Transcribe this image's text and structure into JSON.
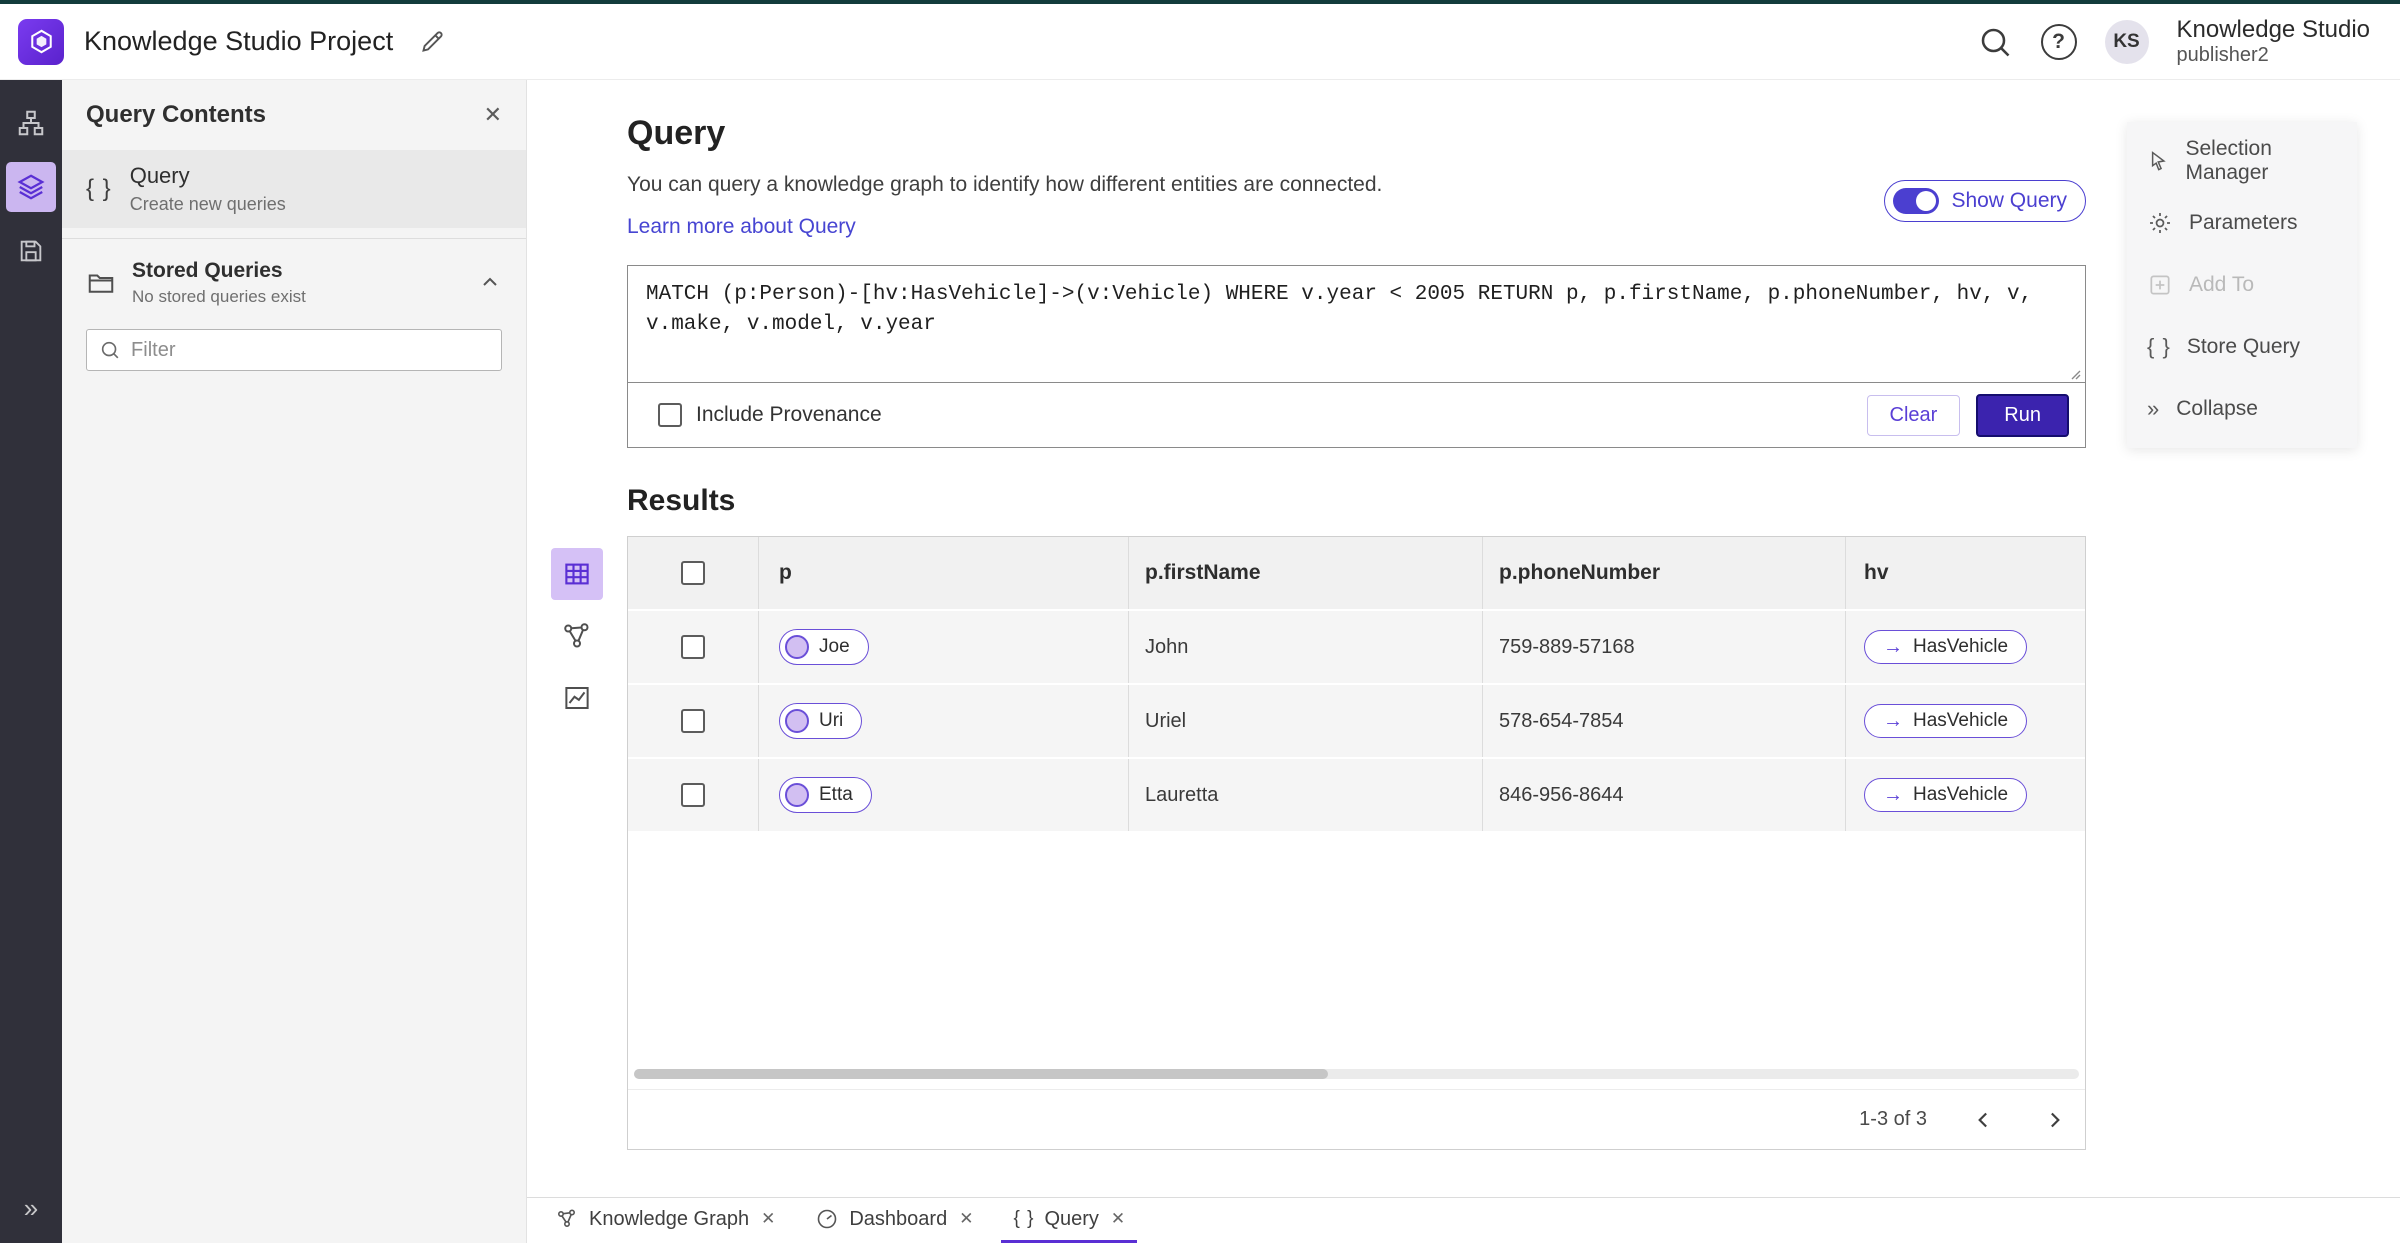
{
  "colors": {
    "accent_purple": "#5a2fd4",
    "run_button": "#3b23ae",
    "link": "#4745d2",
    "toggle": "#4b3fd0",
    "rail_bg": "#30303a",
    "panel_bg": "#f4f4f4",
    "node_pill_fill": "#d2bff2"
  },
  "icons": {
    "braces": "{ }",
    "close": "✕",
    "collapse": "»",
    "edge_arrow": "→",
    "help": "?"
  },
  "header": {
    "app_title": "Knowledge Studio Project",
    "user_initials": "KS",
    "account_name": "Knowledge Studio",
    "account_role": "publisher2"
  },
  "left_panel": {
    "title": "Query Contents",
    "query_item": {
      "label": "Query",
      "sublabel": "Create new queries"
    },
    "stored_queries": {
      "label": "Stored Queries",
      "sublabel": "No stored queries exist"
    },
    "filter_placeholder": "Filter"
  },
  "query": {
    "title": "Query",
    "description": "You can query a knowledge graph to identify how different entities are connected.",
    "learn_more": "Learn more about Query",
    "show_query": "Show Query",
    "text": "MATCH (p:Person)-[hv:HasVehicle]->(v:Vehicle) WHERE v.year < 2005 RETURN p, p.firstName, p.phoneNumber, hv, v, v.make, v.model, v.year",
    "include_provenance": "Include Provenance",
    "clear": "Clear",
    "run": "Run"
  },
  "results": {
    "title": "Results",
    "columns": [
      "p",
      "p.firstName",
      "p.phoneNumber",
      "hv"
    ],
    "rows": [
      {
        "p": "Joe",
        "firstName": "John",
        "phone": "759-889-57168",
        "hv": "HasVehicle"
      },
      {
        "p": "Uri",
        "firstName": "Uriel",
        "phone": "578-654-7854",
        "hv": "HasVehicle"
      },
      {
        "p": "Etta",
        "firstName": "Lauretta",
        "phone": "846-956-8644",
        "hv": "HasVehicle"
      }
    ],
    "pagination": "1-3 of 3"
  },
  "right_menu": {
    "items": [
      {
        "label": "Selection Manager",
        "icon": "selection-manager-icon",
        "disabled": false
      },
      {
        "label": "Parameters",
        "icon": "parameters-icon",
        "disabled": false
      },
      {
        "label": "Add To",
        "icon": "add-to-icon",
        "disabled": true
      },
      {
        "label": "Store Query",
        "icon": "store-query-icon",
        "disabled": false
      },
      {
        "label": "Collapse",
        "icon": "collapse-icon",
        "disabled": false
      }
    ]
  },
  "tabs": [
    {
      "label": "Knowledge Graph",
      "icon": "knowledge-graph-icon",
      "active": false
    },
    {
      "label": "Dashboard",
      "icon": "dashboard-icon",
      "active": false
    },
    {
      "label": "Query",
      "icon": "braces-icon",
      "active": true
    }
  ]
}
